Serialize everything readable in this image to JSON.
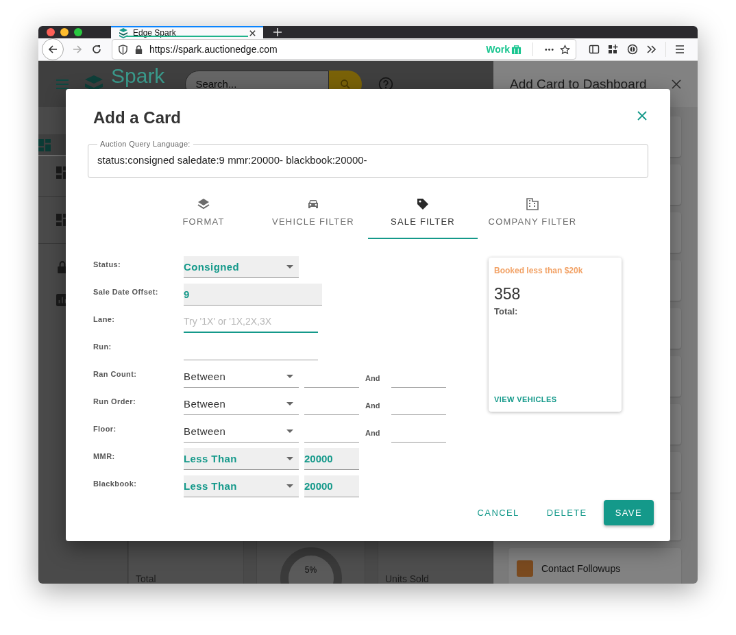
{
  "browser": {
    "tab_title": "Edge Spark",
    "url": "https://spark.auctionedge.com",
    "container_label": "Work"
  },
  "background": {
    "logo_text": "Spark",
    "search_placeholder": "Search...",
    "panel_title": "Add Card to Dashboard",
    "stats": [
      {
        "label": "Total"
      },
      {
        "label": "5%"
      },
      {
        "label": "Units Sold"
      }
    ],
    "panel_item": "Contact Followups"
  },
  "dialog": {
    "title": "Add a Card",
    "query": {
      "label": "Auction Query Language:",
      "value": "status:consigned saledate:9 mmr:20000- blackbook:20000-"
    },
    "tabs": [
      {
        "label": "FORMAT",
        "selected": false
      },
      {
        "label": "VEHICLE FILTER",
        "selected": false
      },
      {
        "label": "SALE FILTER",
        "selected": true
      },
      {
        "label": "COMPANY FILTER",
        "selected": false
      }
    ],
    "fields": [
      {
        "label": "Status:",
        "kind": "select",
        "value": "Consigned",
        "active": true
      },
      {
        "label": "Sale Date Offset:",
        "kind": "input",
        "value": "9",
        "active": true,
        "focused": false
      },
      {
        "label": "Lane:",
        "kind": "input",
        "placeholder": "Try '1X' or '1X,2X,3X",
        "active": false,
        "focused": true
      },
      {
        "label": "Run:",
        "kind": "input",
        "active": false,
        "focused": false
      },
      {
        "label": "Ran Count:",
        "kind": "range",
        "operator": "Between",
        "and_label": "And",
        "active": false
      },
      {
        "label": "Run Order:",
        "kind": "range",
        "operator": "Between",
        "and_label": "And",
        "active": false
      },
      {
        "label": "Floor:",
        "kind": "range",
        "operator": "Between",
        "and_label": "And",
        "active": false
      },
      {
        "label": "MMR:",
        "kind": "compare",
        "operator": "Less Than",
        "value": "20000",
        "active": true
      },
      {
        "label": "Blackbook:",
        "kind": "compare",
        "operator": "Less Than",
        "value": "20000",
        "active": true
      }
    ],
    "preview": {
      "title": "Booked less than $20k",
      "count": "358",
      "total_label": "Total:",
      "link": "VIEW VEHICLES"
    },
    "buttons": [
      {
        "label": "CANCEL",
        "kind": "text"
      },
      {
        "label": "DELETE",
        "kind": "text"
      },
      {
        "label": "SAVE",
        "kind": "primary"
      }
    ]
  }
}
